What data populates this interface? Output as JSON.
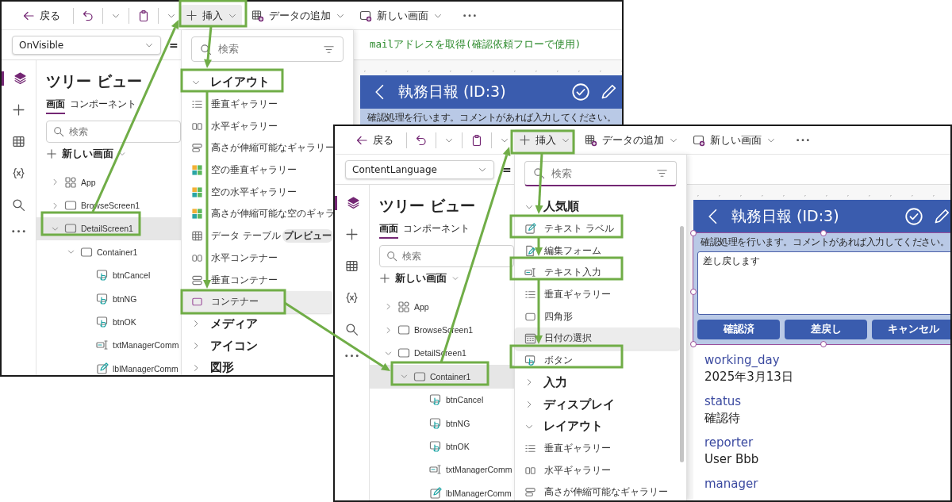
{
  "screenshots": [
    {
      "toolbar": {
        "back": "戻る",
        "insert": {
          "label": "挿入",
          "active": true
        },
        "add_data": "データの追加",
        "new_screen": "新しい画面"
      },
      "formula_bar": {
        "property": "OnVisible",
        "operator": "=",
        "formula": "mailアドレスを取得(確認依頼フローで使用)"
      },
      "rail": [
        {
          "kind": "layers",
          "selected": true
        },
        {
          "kind": "insert",
          "selected": false
        },
        {
          "kind": "data",
          "selected": false
        },
        {
          "kind": "variables",
          "selected": false
        },
        {
          "kind": "search",
          "selected": false
        },
        {
          "kind": "more",
          "selected": false
        }
      ],
      "tree_view": {
        "title": "ツリー ビュー",
        "tabs": [
          {
            "label": "画面",
            "selected": true
          },
          {
            "label": "コンポーネント",
            "selected": false
          }
        ],
        "search_placeholder": "検索",
        "new_screen": "新しい画面",
        "items": [
          {
            "label": "App",
            "kind": "app",
            "expanded": false,
            "selected": false
          },
          {
            "label": "BrowseScreen1",
            "kind": "screen",
            "expanded": false,
            "selected": false
          },
          {
            "label": "DetailScreen1",
            "kind": "screen",
            "expanded": true,
            "selected": true,
            "children": [
              {
                "label": "Container1",
                "kind": "container",
                "expanded": true,
                "selected": false,
                "children": [
                  {
                    "label": "btnCancel",
                    "kind": "button",
                    "selected": false
                  },
                  {
                    "label": "btnNG",
                    "kind": "button",
                    "selected": false
                  },
                  {
                    "label": "btnOK",
                    "kind": "button",
                    "selected": false
                  },
                  {
                    "label": "txtManagerComm",
                    "kind": "text_input",
                    "selected": false
                  },
                  {
                    "label": "lblManagerComm",
                    "kind": "label",
                    "selected": false
                  }
                ]
              }
            ]
          }
        ]
      },
      "insert_menu": {
        "search": {
          "placeholder": "検索",
          "focused": false
        },
        "entries": [
          {
            "kind": "section",
            "label": "レイアウト",
            "expanded": true
          },
          {
            "kind": "vgallery",
            "label": "垂直ギャラリー",
            "hovered": false
          },
          {
            "kind": "hgallery",
            "label": "水平ギャラリー",
            "hovered": false
          },
          {
            "kind": "flexgallery",
            "label": "高さが伸縮可能なギャラリー",
            "hovered": false
          },
          {
            "kind": "blankgallery",
            "label": "空の垂直ギャラリー",
            "hovered": false
          },
          {
            "kind": "blankgallery",
            "label": "空の水平ギャラリー",
            "hovered": false
          },
          {
            "kind": "blankgallery",
            "label": "高さが伸縮可能な空のギャラ",
            "hovered": false
          },
          {
            "kind": "table",
            "label": "データ テーブル",
            "badge": "プレビュー",
            "hovered": false
          },
          {
            "kind": "hcontainer",
            "label": "水平コンテナー",
            "hovered": false
          },
          {
            "kind": "vcontainer",
            "label": "垂直コンテナー",
            "hovered": false
          },
          {
            "kind": "container",
            "label": "コンテナー",
            "hovered": true
          },
          {
            "kind": "section",
            "label": "メディア",
            "expanded": false
          },
          {
            "kind": "section",
            "label": "アイコン",
            "expanded": false
          },
          {
            "kind": "section",
            "label": "図形",
            "expanded": false
          }
        ]
      },
      "preview": {
        "title": "執務日報 (ID:3)",
        "instruction": "確認処理を行います。コメントがあれば入力してください。"
      }
    },
    {
      "toolbar": {
        "back": "戻る",
        "insert": {
          "label": "挿入",
          "active": true
        },
        "add_data": "データの追加",
        "new_screen": "新しい画面"
      },
      "formula_bar": {
        "property": "ContentLanguage",
        "operator": "="
      },
      "rail": [
        {
          "kind": "layers",
          "selected": true
        },
        {
          "kind": "insert",
          "selected": false
        },
        {
          "kind": "data",
          "selected": false
        },
        {
          "kind": "variables",
          "selected": false
        },
        {
          "kind": "search",
          "selected": false
        },
        {
          "kind": "more",
          "selected": false
        }
      ],
      "tree_view": {
        "title": "ツリー ビュー",
        "tabs": [
          {
            "label": "画面",
            "selected": true
          },
          {
            "label": "コンポーネント",
            "selected": false
          }
        ],
        "search_placeholder": "検索",
        "new_screen": "新しい画面",
        "items": [
          {
            "label": "App",
            "kind": "app",
            "expanded": false,
            "selected": false
          },
          {
            "label": "BrowseScreen1",
            "kind": "screen",
            "expanded": false,
            "selected": false
          },
          {
            "label": "DetailScreen1",
            "kind": "screen",
            "expanded": true,
            "selected": false,
            "children": [
              {
                "label": "Container1",
                "kind": "container",
                "expanded": true,
                "selected": true,
                "children": [
                  {
                    "label": "btnCancel",
                    "kind": "button",
                    "selected": false
                  },
                  {
                    "label": "btnNG",
                    "kind": "button",
                    "selected": false
                  },
                  {
                    "label": "btnOK",
                    "kind": "button",
                    "selected": false
                  },
                  {
                    "label": "txtManagerComm",
                    "kind": "text_input",
                    "selected": false
                  },
                  {
                    "label": "lblManagerComm",
                    "kind": "label",
                    "selected": false
                  }
                ]
              }
            ]
          }
        ]
      },
      "insert_menu": {
        "search": {
          "placeholder": "検索",
          "focused": true
        },
        "entries": [
          {
            "kind": "section",
            "label": "人気順",
            "expanded": true
          },
          {
            "kind": "label",
            "label": "テキスト ラベル",
            "hovered": false
          },
          {
            "kind": "form",
            "label": "編集フォーム",
            "hovered": false
          },
          {
            "kind": "textinput",
            "label": "テキスト入力",
            "hovered": false
          },
          {
            "kind": "vgallery",
            "label": "垂直ギャラリー",
            "hovered": false
          },
          {
            "kind": "rectangle",
            "label": "四角形",
            "hovered": false
          },
          {
            "kind": "datepicker",
            "label": "日付の選択",
            "hovered": true
          },
          {
            "kind": "button",
            "label": "ボタン",
            "hovered": false
          },
          {
            "kind": "section",
            "label": "入力",
            "expanded": false
          },
          {
            "kind": "section",
            "label": "ディスプレイ",
            "expanded": false
          },
          {
            "kind": "section",
            "label": "レイアウト",
            "expanded": true
          },
          {
            "kind": "vgallery",
            "label": "垂直ギャラリー",
            "hovered": false
          },
          {
            "kind": "hgallery",
            "label": "水平ギャラリー",
            "hovered": false
          },
          {
            "kind": "flexgallery",
            "label": "高さが伸縮可能なギャラリー",
            "hovered": false
          }
        ]
      },
      "preview": {
        "title": "執務日報 (ID:3)",
        "instruction": "確認処理を行います。コメントがあれば入力してください。",
        "container_selected": true,
        "comment": "差し戻します",
        "buttons": [
          "確認済",
          "差戻し",
          "キャンセル"
        ],
        "fields": [
          {
            "label": "working_day",
            "value": "2025年3月13日"
          },
          {
            "label": "status",
            "value": "確認待"
          },
          {
            "label": "reporter",
            "value": "User Bbb"
          },
          {
            "label": "manager"
          }
        ]
      }
    }
  ]
}
